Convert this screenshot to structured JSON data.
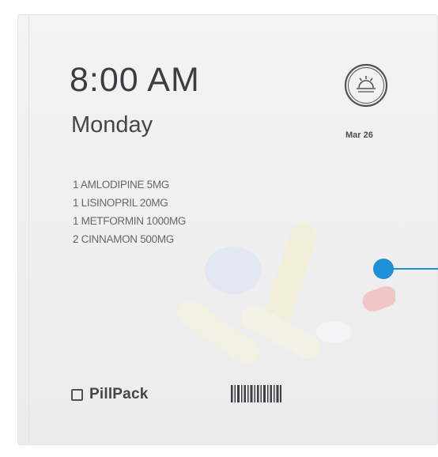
{
  "dose": {
    "time": "8:00 AM",
    "day": "Monday",
    "date": "Mar 26",
    "time_of_day_icon": "sunrise-icon"
  },
  "medications": [
    {
      "label": "1 AMLODIPINE 5MG"
    },
    {
      "label": "1 LISINOPRIL 20MG"
    },
    {
      "label": "1 METFORMIN 1000MG"
    },
    {
      "label": "2 CINNAMON 500MG"
    }
  ],
  "brand": {
    "name": "PillPack",
    "logo_icon": "square-logo-icon",
    "barcode_icon": "barcode-icon"
  },
  "colors": {
    "text_dark": "#3c3d40",
    "text_muted": "#66676b",
    "packet": "#f0f0f1",
    "connector": "#1e8fd8"
  }
}
